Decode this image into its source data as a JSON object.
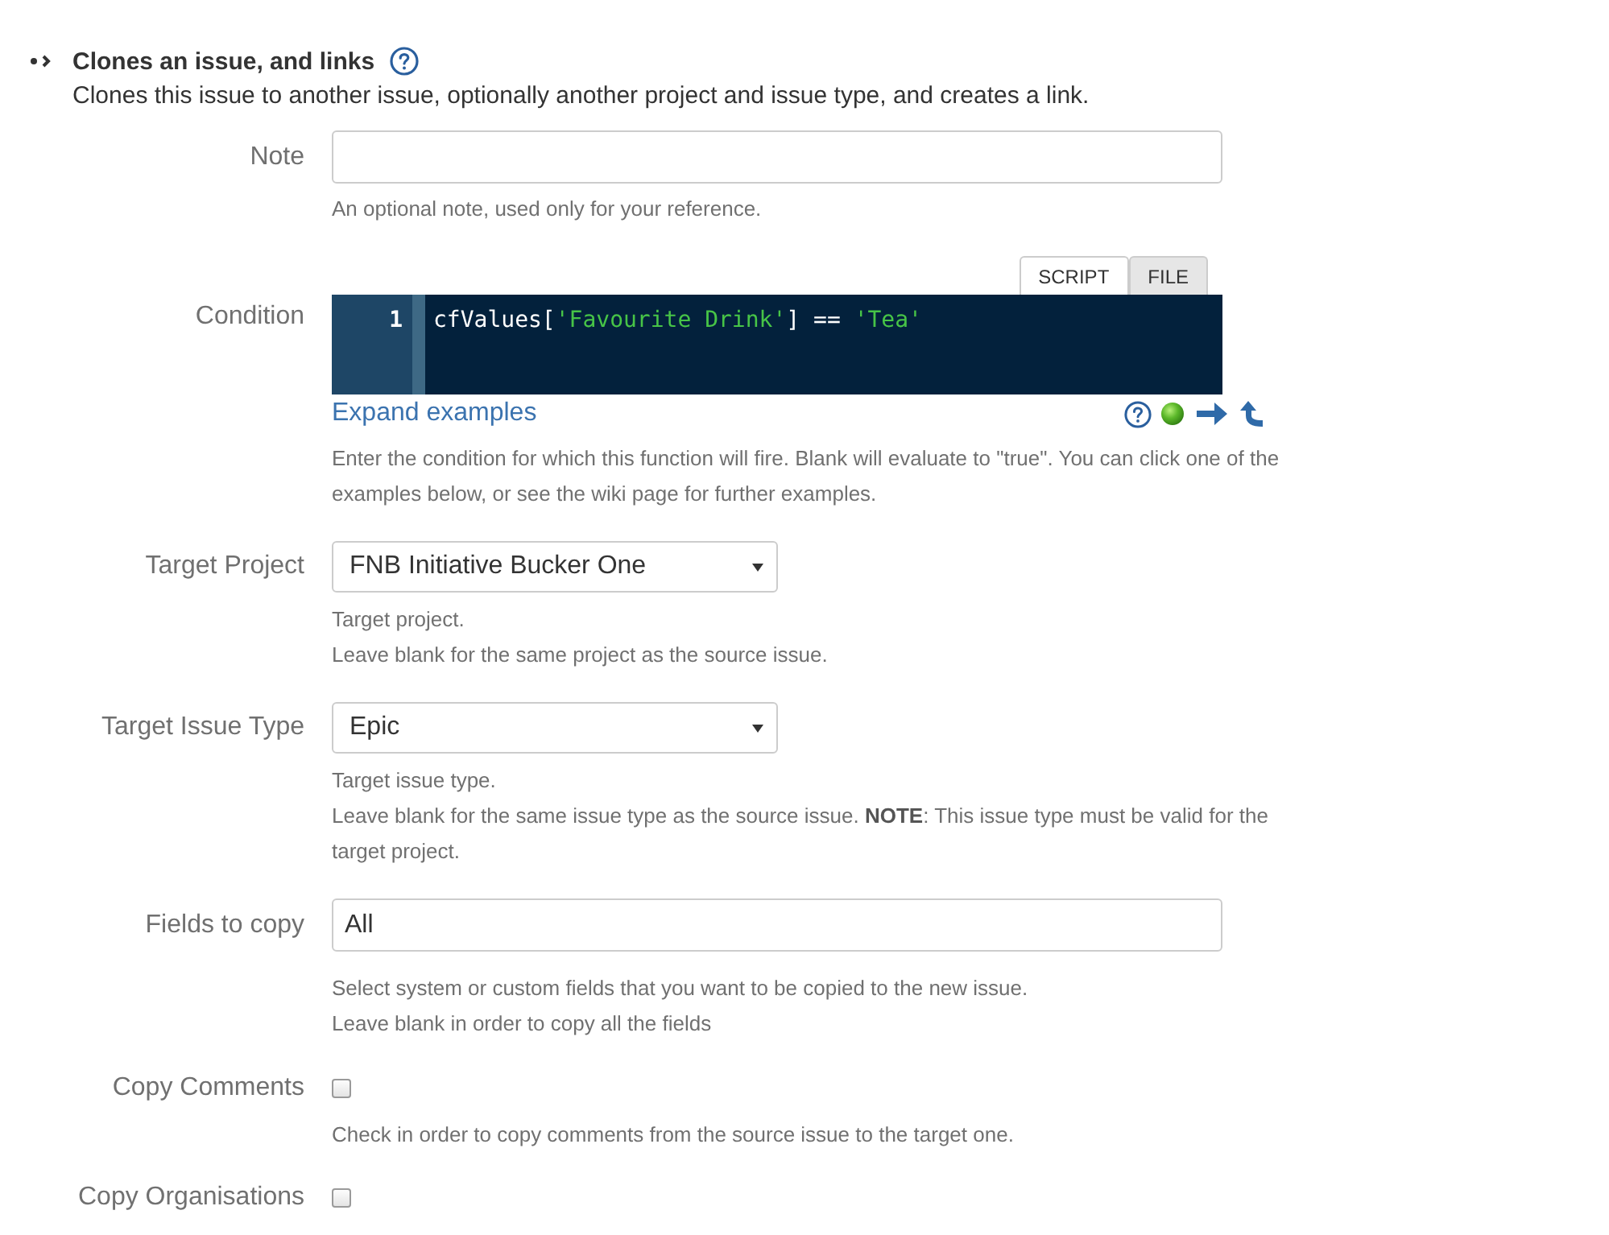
{
  "section": {
    "title": "Clones an issue, and links",
    "description": "Clones this issue to another issue, optionally another project and issue type, and creates a link."
  },
  "fields": [
    {
      "kind": "text",
      "label": "Note",
      "hints": [
        "An optional note, used only for your reference."
      ]
    },
    {
      "kind": "code",
      "label": "Condition",
      "tabs": [
        {
          "label": "SCRIPT",
          "selected": true
        },
        {
          "label": "FILE",
          "selected": false
        }
      ],
      "lines": [
        {
          "number": "1",
          "tokens": [
            {
              "kind": "plain",
              "text": "cfValues["
            },
            {
              "kind": "string",
              "text": "'Favourite Drink'"
            },
            {
              "kind": "plain",
              "text": "] == "
            },
            {
              "kind": "string",
              "text": "'Tea'"
            }
          ]
        }
      ],
      "link": "Expand examples",
      "hints": [
        "Enter the condition for which this function will fire. Blank will evaluate to \"true\". You can click one of the examples below, or see the wiki page for further examples."
      ]
    },
    {
      "kind": "select",
      "label": "Target Project",
      "value": "FNB Initiative Bucker One",
      "hints": [
        "Target project.",
        "Leave blank for the same project as the source issue."
      ]
    },
    {
      "kind": "select",
      "label": "Target Issue Type",
      "value": "Epic",
      "hints": [
        "Target issue type.",
        "Leave blank for the same issue type as the source issue. **NOTE**: This issue type must be valid for the target project."
      ]
    },
    {
      "kind": "multi",
      "label": "Fields to copy",
      "value": "All",
      "hints": [
        "Select system or custom fields that you want to be copied to the new issue.",
        "Leave blank in order to copy all the fields"
      ]
    },
    {
      "kind": "checkbox",
      "label": "Copy Comments",
      "checked": false,
      "hints": [
        "Check in order to copy comments from the source issue to the target one."
      ]
    },
    {
      "kind": "checkbox",
      "label": "Copy Organisations",
      "checked": false
    }
  ]
}
